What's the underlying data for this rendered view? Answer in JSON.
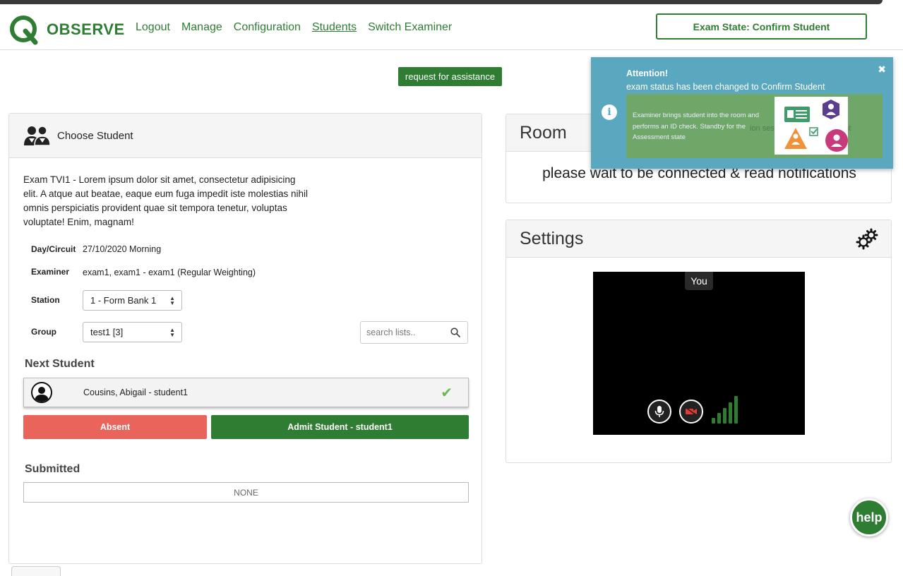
{
  "header": {
    "logo_text": "OBSERVE",
    "nav": [
      "Logout",
      "Manage",
      "Configuration",
      "Students",
      "Switch Examiner"
    ],
    "exam_state": "Exam State: Confirm Student"
  },
  "assist_button": "request for assistance",
  "choose_panel": {
    "title": "Choose Student",
    "description": "Exam TVI1 - Lorem ipsum dolor sit amet, consectetur adipisicing elit. A atque aut beatae, eaque eum fuga impedit iste molestias nihil omnis perspiciatis provident quae sit tempora tenetur, voluptas voluptate! Enim, magnam!",
    "day_label": "Day/Circuit",
    "day_value": "27/10/2020 Morning",
    "examiner_label": "Examiner",
    "examiner_value": "exam1, exam1 - exam1 (Regular Weighting)",
    "station_label": "Station",
    "station_value": "1 - Form Bank 1",
    "group_label": "Group",
    "group_value": "test1 [3]",
    "search_placeholder": "search lists..",
    "next_student_title": "Next Student",
    "next_student_name": "Cousins, Abigail - student1",
    "absent_label": "Absent",
    "admit_label": "Admit Student - student1",
    "submitted_title": "Submitted",
    "submitted_value": "NONE"
  },
  "room_panel": {
    "title": "Room",
    "message": "please wait to be connected & read notifications"
  },
  "settings_panel": {
    "title": "Settings",
    "video_label": "You",
    "signal_level": 5
  },
  "toast": {
    "title": "Attention!",
    "message": "exam status has been changed to Confirm Student",
    "banner_text": "Examiner brings student into the room and performs an ID check. Standby for the Assessment state",
    "ghost_text": "ion session | Confirm Student"
  },
  "help_label": "help",
  "colors": {
    "brand_green": "#2e7d32",
    "absent_red": "#e9645a",
    "toast_blue": "#5aa8c0"
  }
}
